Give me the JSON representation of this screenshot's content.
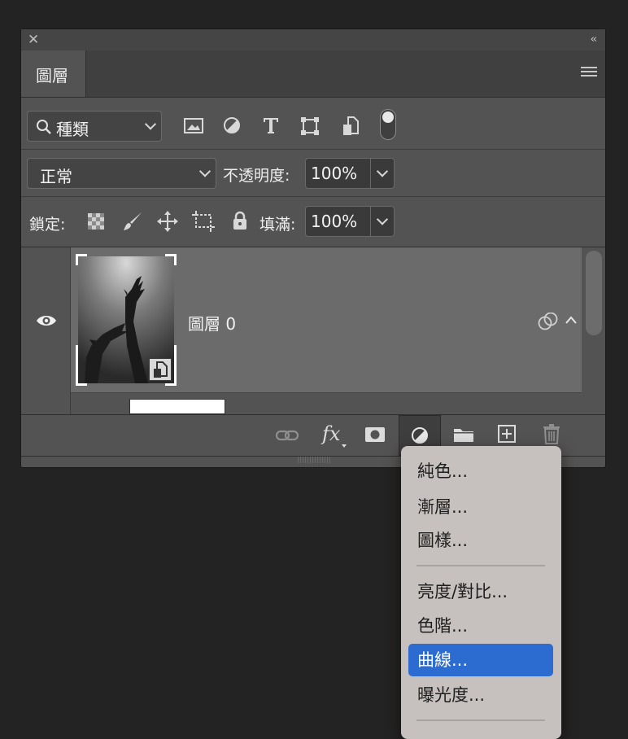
{
  "panel": {
    "tab_label": "圖層",
    "filter": {
      "kind_label": "種類"
    },
    "blend": {
      "mode": "正常",
      "opacity_label": "不透明度:",
      "opacity_value": "100%"
    },
    "lock": {
      "label": "鎖定:",
      "fill_label": "填滿:",
      "fill_value": "100%"
    },
    "layers": [
      {
        "name": "圖層 0"
      }
    ]
  },
  "adjustment_menu": {
    "group1": [
      "純色...",
      "漸層...",
      "圖樣..."
    ],
    "group2": [
      "亮度/對比...",
      "色階...",
      "曲線...",
      "曝光度..."
    ],
    "active_item": "曲線..."
  },
  "colors": {
    "panel_bg": "#535353",
    "selected_layer": "#6b6b6b",
    "menu_highlight": "#2c6cd1",
    "menu_bg": "#c6c1be"
  },
  "icons": {
    "filter": [
      "image-icon",
      "adjustment-icon",
      "type-icon",
      "shape-icon",
      "smart-object-icon",
      "filter-toggle-icon"
    ],
    "lock": [
      "lock-transparent-icon",
      "lock-paint-icon",
      "lock-move-icon",
      "lock-artboard-icon",
      "lock-all-icon"
    ],
    "bottom": [
      "link-icon",
      "fx-icon",
      "mask-icon",
      "adjustment-icon",
      "folder-icon",
      "new-layer-icon",
      "trash-icon"
    ]
  }
}
